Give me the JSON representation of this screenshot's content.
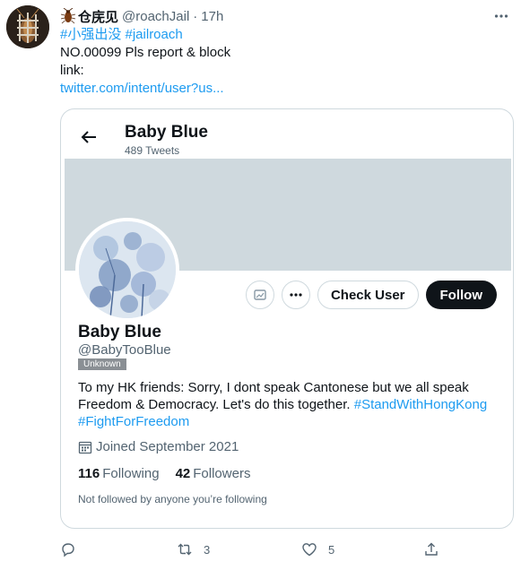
{
  "tweet": {
    "author": {
      "display_name": "仓庑见",
      "handle": "@roachJail",
      "separator": "·",
      "time": "17h",
      "avatar_icon": "roach-avatar"
    },
    "body": {
      "hashtags_line": "#小强出没 #jailroach",
      "line2": "NO.00099 Pls report & block",
      "line3": "link:",
      "link": "twitter.com/intent/user?us..."
    },
    "more_icon": "more-horizontal-icon"
  },
  "card": {
    "header_name": "Baby Blue",
    "tweet_count": "489 Tweets",
    "profile": {
      "name": "Baby Blue",
      "handle": "@BabyTooBlue",
      "badge": "Unknown",
      "bio_line1": "To my HK friends: Sorry, I dont speak Cantonese but we all speak",
      "bio_line2_text": "Freedom & Democracy. Let's do this together. ",
      "bio_line2_tag": "#StandWithHongKong",
      "bio_line3_tag": "#FightForFreedom",
      "joined": "Joined September 2021",
      "following_count": "116",
      "following_label": "Following",
      "followers_count": "42",
      "followers_label": "Followers",
      "not_followed": "Not followed by anyone you’re following"
    },
    "buttons": {
      "check_user": "Check User",
      "follow": "Follow"
    },
    "colors": {
      "banner": "#cfd9de",
      "follow_bg": "#0f1419",
      "link": "#1d9bf0"
    }
  },
  "footer": {
    "reply_count": "",
    "retweet_count": "3",
    "like_count": "5"
  }
}
